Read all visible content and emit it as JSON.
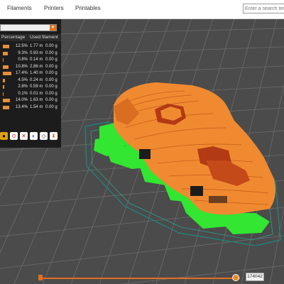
{
  "nav": {
    "links": [
      "Filaments",
      "Printers",
      "Printables"
    ],
    "search_placeholder": "Enter a search term"
  },
  "panel": {
    "columns": [
      "Percentage",
      "Used filament"
    ],
    "rows": [
      {
        "percentage": "12.5%",
        "length": "1.77 m",
        "weight": "0.00 g",
        "fill": 0.125
      },
      {
        "percentage": "9.3%",
        "length": "0.93 m",
        "weight": "0.00 g",
        "fill": 0.093
      },
      {
        "percentage": "0.8%",
        "length": "0.14 m",
        "weight": "0.00 g",
        "fill": 0.008
      },
      {
        "percentage": "10.8%",
        "length": "2.86 m",
        "weight": "0.00 g",
        "fill": 0.108
      },
      {
        "percentage": "17.4%",
        "length": "1.40 m",
        "weight": "0.00 g",
        "fill": 0.174
      },
      {
        "percentage": "4.5%",
        "length": "0.24 m",
        "weight": "0.00 g",
        "fill": 0.045
      },
      {
        "percentage": "2.8%",
        "length": "0.59 m",
        "weight": "0.00 g",
        "fill": 0.028
      },
      {
        "percentage": "0.1%",
        "length": "0.01 m",
        "weight": "0.00 g",
        "fill": 0.001
      },
      {
        "percentage": "14.0%",
        "length": "1.63 m",
        "weight": "0.00 g",
        "fill": 0.14
      },
      {
        "percentage": "13.4%",
        "length": "1.54 m",
        "weight": "0.00 g",
        "fill": 0.134
      }
    ]
  },
  "slider": {
    "value": "174042",
    "position": 0.98
  },
  "colors": {
    "bed": "#4b4b4b",
    "grid": "#6c6c6c",
    "model_orange": "#f08a30",
    "model_dark": "#b23a14",
    "support_green": "#32e632",
    "accent": "#e07020"
  }
}
